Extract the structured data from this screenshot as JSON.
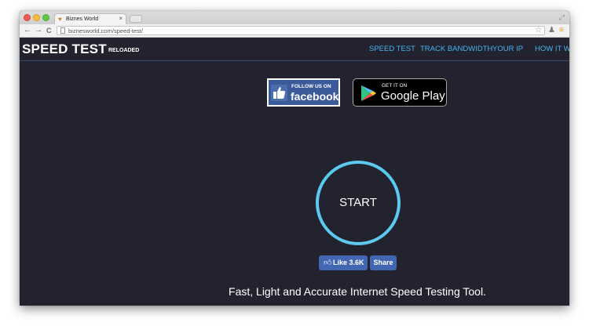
{
  "browser": {
    "tab_title": "Biznes World",
    "tab_close": "×",
    "url": "biznesworld.com/speed-test/",
    "back": "←",
    "forward": "→",
    "reload": "C"
  },
  "site": {
    "logo": "SPEED TEST",
    "logo_sub": "RELOADED",
    "nav": [
      "SPEED TEST",
      "TRACK BANDWIDTH",
      "YOUR IP",
      "HOW IT WORKS"
    ]
  },
  "badges": {
    "facebook_line1": "FOLLOW US ON",
    "facebook_line2": "facebook",
    "google_line1": "GET IT ON",
    "google_line2": "Google Play"
  },
  "start_label": "START",
  "social": {
    "like_label": "Like 3.6K",
    "share_label": "Share"
  },
  "tagline": "Fast, Light and Accurate Internet Speed Testing Tool.",
  "colors": {
    "page_bg": "#23222f",
    "accent_ring": "#5cc9ef",
    "nav_link": "#47b4ee",
    "facebook_blue": "#3b5a9a",
    "fb_button": "#4267b2"
  }
}
